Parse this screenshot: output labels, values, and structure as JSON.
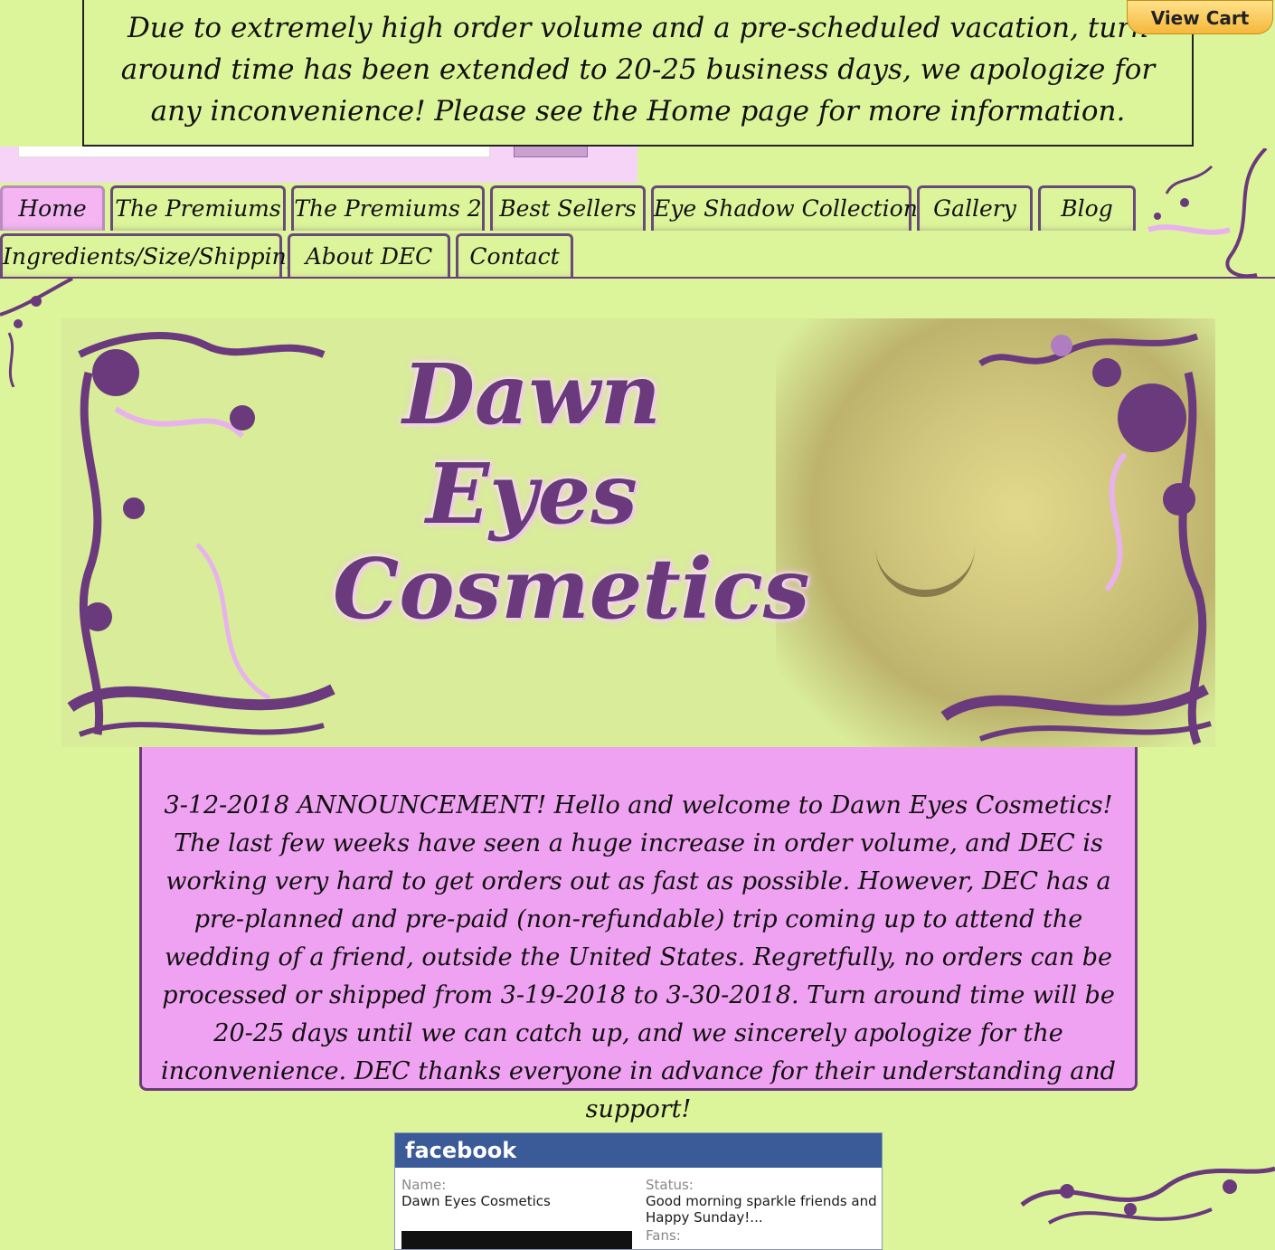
{
  "notice": {
    "text": "Due to extremely high order volume and a pre-scheduled vacation, turn around time has been extended to 20-25 business days, we apologize for any inconvenience! Please see the Home page for more information."
  },
  "cart": {
    "label": "View Cart"
  },
  "nav": {
    "row1": [
      "Home",
      "The Premiums",
      "The Premiums 2",
      "Best Sellers",
      "Eye Shadow Collections",
      "Gallery",
      "Blog"
    ],
    "row2": [
      "Ingredients/Size/Shipping",
      "About DEC",
      "Contact"
    ],
    "active": "Home"
  },
  "header": {
    "logo_line1": "Dawn",
    "logo_line2": "Eyes",
    "logo_line3": "Cosmetics"
  },
  "announcement": {
    "text": "3-12-2018 ANNOUNCEMENT! Hello and welcome to Dawn Eyes Cosmetics! The last few weeks have seen a huge increase in order volume, and DEC is working very hard to get orders out as fast as possible. However, DEC has a pre-planned and pre-paid (non-refundable) trip coming up to attend the wedding of a friend, outside the United States. Regretfully, no orders can be processed or shipped from 3-19-2018 to 3-30-2018. Turn around time will be 20-25 days until we can catch up, and we sincerely apologize for the inconvenience. DEC thanks everyone in advance for their understanding and support!"
  },
  "facebook": {
    "brand": "facebook",
    "name_label": "Name:",
    "name_value": "Dawn Eyes Cosmetics",
    "status_label": "Status:",
    "status_value": "Good morning sparkle friends and Happy Sunday!...",
    "fans_label": "Fans:"
  },
  "colors": {
    "page_bg": "#ddf59a",
    "accent_purple": "#6a3a7c",
    "announce_bg": "#f0a2f2",
    "fb_blue": "#3b5a98"
  }
}
